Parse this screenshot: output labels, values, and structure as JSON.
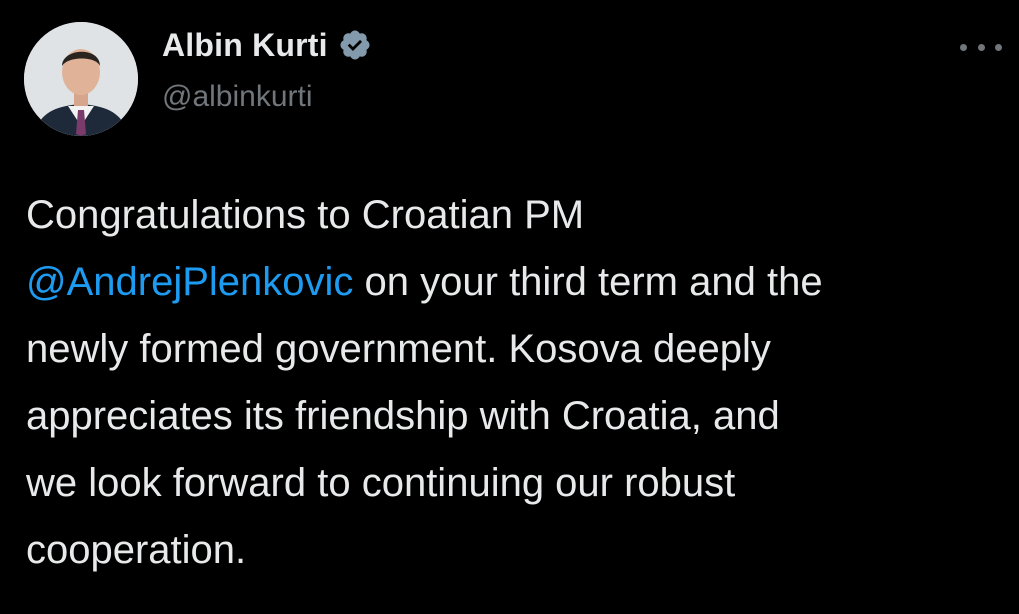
{
  "author": {
    "display_name": "Albin Kurti",
    "handle": "@albinkurti",
    "verified": true,
    "verified_icon": "verified-badge-icon",
    "avatar_icon": "profile-photo"
  },
  "menu": {
    "icon": "more-horizontal-icon"
  },
  "tweet": {
    "line1": "Congratulations to Croatian PM",
    "mention": "@AndrejPlenkovic",
    "line2_rest": " on your third term and the",
    "line3": "newly formed government. Kosova deeply",
    "line4": "appreciates its friendship with Croatia, and",
    "line5": "we look forward to continuing our robust",
    "line6": "cooperation."
  },
  "colors": {
    "background": "#000000",
    "text": "#e7e9ea",
    "secondary": "#71767b",
    "link": "#1d9bf0",
    "badge": "#829aab"
  }
}
